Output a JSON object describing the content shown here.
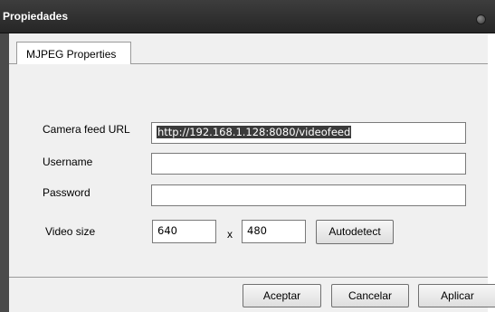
{
  "window": {
    "title": "Propiedades"
  },
  "tabs": [
    {
      "label": "MJPEG Properties"
    }
  ],
  "form": {
    "camera_feed_url": {
      "label": "Camera feed URL",
      "value": "http://192.168.1.128:8080/videofeed"
    },
    "username": {
      "label": "Username",
      "value": ""
    },
    "password": {
      "label": "Password",
      "value": ""
    },
    "video_size": {
      "label": "Video size",
      "width": "640",
      "separator": "x",
      "height": "480",
      "autodetect_label": "Autodetect"
    }
  },
  "footer": {
    "ok_label": "Aceptar",
    "cancel_label": "Cancelar",
    "apply_label": "Aplicar"
  }
}
